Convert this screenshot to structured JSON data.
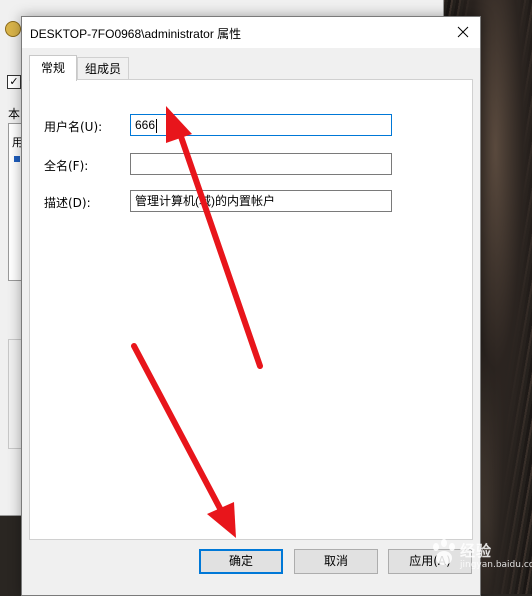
{
  "dialog": {
    "title": "DESKTOP-7FO0968\\administrator 属性",
    "tabs": [
      {
        "label": "常规",
        "active": true
      },
      {
        "label": "组成员",
        "active": false
      }
    ],
    "fields": [
      {
        "label": "用户名(U):",
        "value": "666"
      },
      {
        "label": "全名(F):",
        "value": ""
      },
      {
        "label": "描述(D):",
        "value": "管理计算机(域)的内置帐户"
      }
    ],
    "buttons": {
      "ok": "确定",
      "cancel": "取消",
      "apply": "应用(A)"
    }
  },
  "parent_window": {
    "partial_label": "本",
    "partial_list_item": "用",
    "check_mark": "✓"
  },
  "watermark": {
    "text": "经验",
    "url": "jingyan.baidu.com"
  },
  "colors": {
    "annotation_arrow": "#e8151b",
    "focus_border": "#0078d7"
  }
}
